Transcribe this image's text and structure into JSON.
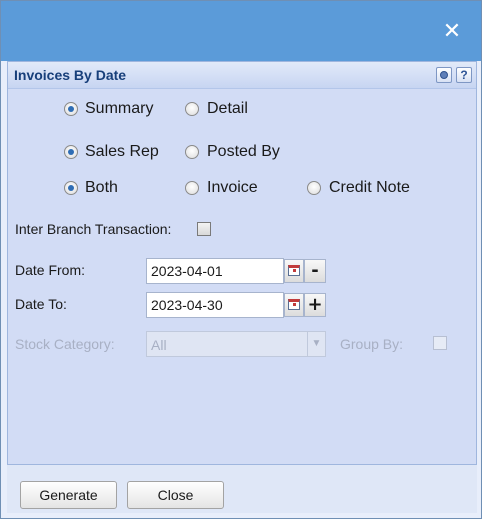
{
  "titlebar": {
    "close_glyph": "✕"
  },
  "panel": {
    "title": "Invoices By Date",
    "gear_icon": "gear-icon",
    "help_label": "?"
  },
  "report_type": {
    "options": [
      {
        "label": "Summary",
        "checked": true
      },
      {
        "label": "Detail",
        "checked": false
      }
    ]
  },
  "group_basis": {
    "options": [
      {
        "label": "Sales Rep",
        "checked": true
      },
      {
        "label": "Posted By",
        "checked": false
      }
    ]
  },
  "document_type": {
    "options": [
      {
        "label": "Both",
        "checked": true
      },
      {
        "label": "Invoice",
        "checked": false
      },
      {
        "label": "Credit Note",
        "checked": false
      }
    ]
  },
  "inter_branch": {
    "label": "Inter Branch Transaction:",
    "checked": false
  },
  "date_from": {
    "label": "Date From:",
    "value": "2023-04-01",
    "step_label": "-"
  },
  "date_to": {
    "label": "Date To:",
    "value": "2023-04-30",
    "step_label": "+"
  },
  "stock_category": {
    "label": "Stock Category:",
    "value": "All"
  },
  "group_by": {
    "label": "Group By:",
    "checked": false
  },
  "footer": {
    "generate_label": "Generate",
    "close_label": "Close"
  },
  "colors": {
    "titlebar": "#5b9bd9",
    "panel_bg": "#d2dcf5",
    "radio_selected": "#2f6db5"
  }
}
